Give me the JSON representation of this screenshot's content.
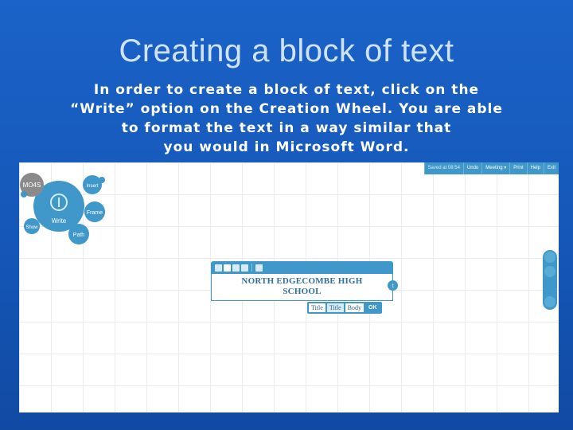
{
  "slide": {
    "title": "Creating a block of text",
    "body_lines": [
      "In order to create a block of text, click on the",
      "“Write” option on the Creation Wheel. You are able",
      "to format the text in a way similar that",
      "you would in Microsoft Word."
    ]
  },
  "prezi": {
    "topbar": {
      "saved": "Saved at 08:54",
      "undo": "Undo",
      "meeting": "Meeting ▾",
      "print": "Print",
      "help": "Help",
      "exit": "Exit"
    },
    "wheel": {
      "center_label": "Write",
      "insert": "Insert",
      "frame": "Frame",
      "path": "Path",
      "show": "Show",
      "brand": "MO4S"
    },
    "textbox": {
      "line1": "NORTH EDGECOMBE HIGH",
      "line2": "SCHOOL"
    },
    "styles": {
      "title1": "Title",
      "title2": "Title",
      "body": "Body",
      "ok": "OK"
    },
    "icons": [
      "home-icon",
      "zoom-in-icon",
      "zoom-out-icon",
      "align-left-icon",
      "align-center-icon",
      "align-right-icon",
      "list-icon"
    ]
  },
  "colors": {
    "slide_bg": "#1557b8",
    "accent": "#3f98c9",
    "title": "#cfe3ff"
  }
}
